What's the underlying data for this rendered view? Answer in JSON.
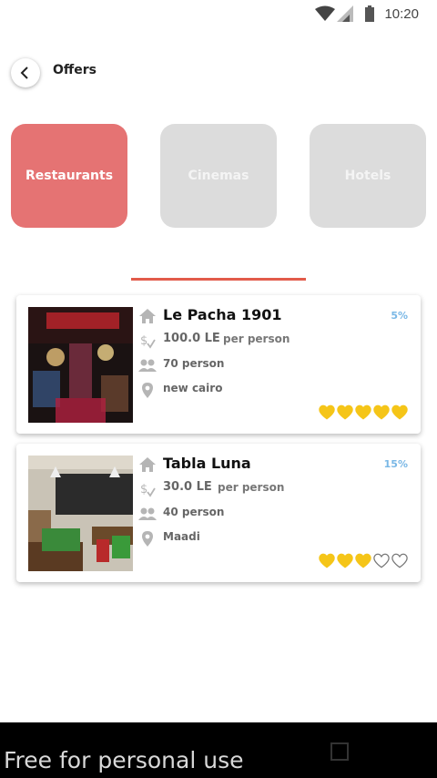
{
  "status_bar": {
    "time": "10:20"
  },
  "header": {
    "title": "Offers"
  },
  "categories": [
    {
      "label": "Restaurants",
      "active": true
    },
    {
      "label": "Cinemas",
      "active": false
    },
    {
      "label": "Hotels",
      "active": false
    }
  ],
  "offers": [
    {
      "name": "Le Pacha 1901",
      "price": "100.0 LE",
      "per": "per person",
      "capacity": "70 person",
      "location": "new cairo",
      "discount": "5%",
      "rating": 5,
      "max_rating": 5
    },
    {
      "name": "Tabla Luna",
      "price": "30.0 LE",
      "per": "per person",
      "capacity": "40 person",
      "location": "Maadi",
      "discount": "15%",
      "rating": 3,
      "max_rating": 5
    }
  ],
  "colors": {
    "accent": "#e57373",
    "indicator": "#e25b4a",
    "discount": "#7ab8e6",
    "heart": "#f5c518"
  },
  "footer": {
    "watermark": "Free for personal use"
  }
}
